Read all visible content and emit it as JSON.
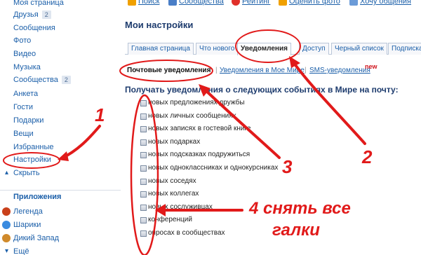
{
  "sidebar": {
    "items": [
      {
        "label": "Моя страница"
      },
      {
        "label": "Друзья",
        "badge": "2"
      },
      {
        "label": "Сообщения"
      },
      {
        "label": "Фото"
      },
      {
        "label": "Видео"
      },
      {
        "label": "Музыка"
      },
      {
        "label": "Сообщества",
        "badge": "2"
      },
      {
        "label": "Анкета"
      },
      {
        "label": "Гости"
      },
      {
        "label": "Подарки"
      },
      {
        "label": "Вещи"
      },
      {
        "label": "Избранные"
      },
      {
        "label": "Настройки"
      },
      {
        "label": "Скрыть"
      }
    ],
    "apps_heading": "Приложения",
    "apps": [
      {
        "label": "Легенда",
        "icon": "legend-icon"
      },
      {
        "label": "Шарики",
        "icon": "balls-icon"
      },
      {
        "label": "Дикий Запад",
        "icon": "wild-west-icon"
      },
      {
        "label": "Ещё",
        "icon": "more-icon"
      }
    ]
  },
  "topbar": {
    "links": [
      "Поиск",
      "Сообщества",
      "Рейтинг",
      "Оценить фото",
      "Хочу общения"
    ]
  },
  "page_title": "Мои настройки",
  "tabs": [
    "Главная страница",
    "Что нового",
    "Уведомления",
    "Доступ",
    "Черный список",
    "Подписка"
  ],
  "subtabs": [
    "Почтовые уведомления",
    "Уведомления в Мое Мире",
    "SMS-уведомления"
  ],
  "new_badge": "new",
  "section_heading": "Получать уведомления о следующих событиях в Мире на почту:",
  "checkboxes": [
    "новых предложениях дружбы",
    "новых личных сообщениях",
    "новых записях в гостевой книге",
    "новых подарках",
    "новых подсказках подружиться",
    "новых одноклассниках и однокурсниках",
    "новых соседях",
    "новых коллегах",
    "новых сослуживцах",
    "конференций",
    "опросах в сообществах"
  ],
  "annotations": {
    "n1": "1",
    "n2": "2",
    "n3": "3",
    "n4": "4 снять все",
    "n4b": "галки"
  },
  "colors": {
    "link": "#1b5fa9",
    "annotation": "#e11a1a",
    "heading": "#1e3c6e"
  }
}
